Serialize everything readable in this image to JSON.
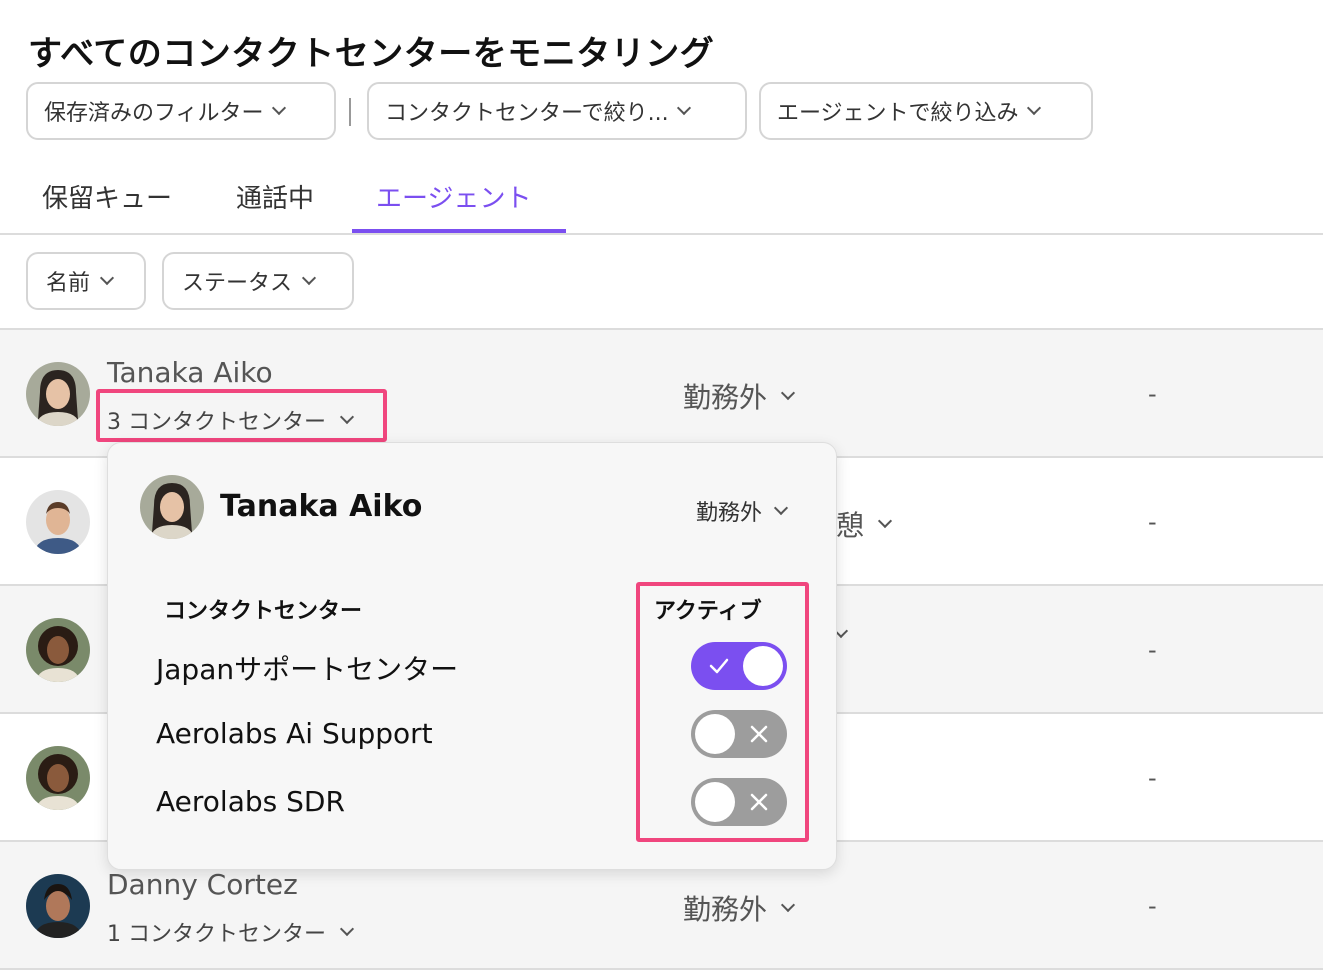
{
  "page": {
    "title": "すべてのコンタクトセンターをモニタリング"
  },
  "filters": {
    "saved": "保存済みのフィルター",
    "contact_center": "コンタクトセンターで絞り...",
    "agent": "エージェントで絞り込み",
    "separator": "|"
  },
  "tabs": [
    {
      "label": "保留キュー"
    },
    {
      "label": "通話中"
    },
    {
      "label": "エージェント",
      "active": true
    }
  ],
  "sub_filters": {
    "name": "名前",
    "status": "ステータス"
  },
  "agents": [
    {
      "name": "Tanaka Aiko",
      "contact_centers": "3 コンタクトセンター",
      "status": "勤務外",
      "value": "-"
    },
    {
      "name": "",
      "contact_centers": "",
      "status": "憩",
      "value": "-"
    },
    {
      "name": "",
      "contact_centers": "",
      "status": "",
      "value": "-"
    },
    {
      "name": "",
      "contact_centers": "",
      "status": "",
      "value": "-"
    },
    {
      "name": "Danny Cortez",
      "contact_centers": "1 コンタクトセンター",
      "status": "勤務外",
      "value": "-"
    }
  ],
  "popup": {
    "name": "Tanaka Aiko",
    "status": "勤務外",
    "col_contact_center": "コンタクトセンター",
    "col_active": "アクティブ",
    "centers": [
      {
        "name": "Japanサポートセンター",
        "active": true
      },
      {
        "name": "Aerolabs Ai Support",
        "active": false
      },
      {
        "name": "Aerolabs SDR",
        "active": false
      }
    ]
  },
  "colors": {
    "accent": "#7b4ff0",
    "highlight": "#f0467e",
    "toggle_off": "#9d9d9d"
  }
}
